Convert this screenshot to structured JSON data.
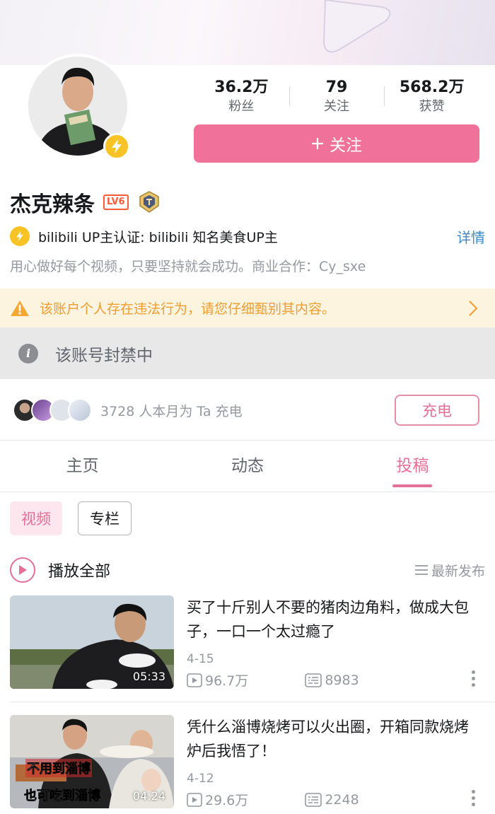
{
  "profile": {
    "name": "杰克辣条",
    "level": "LV6",
    "stats": [
      {
        "value": "36.2万",
        "label": "粉丝"
      },
      {
        "value": "79",
        "label": "关注"
      },
      {
        "value": "568.2万",
        "label": "获赞"
      }
    ],
    "follow_label": "关注",
    "verify_text": "bilibili UP主认证: bilibili 知名美食UP主",
    "detail_label": "详情",
    "bio": "用心做好每个视频，只要坚持就会成功。商业合作：Cy_sxe"
  },
  "warning": {
    "text": "该账户个人存在违法行为，请您仔细甄别其内容。"
  },
  "ban": {
    "text": "该账号封禁中"
  },
  "charge": {
    "text": "3728 人本月为 Ta 充电",
    "button": "充电"
  },
  "tabs": [
    {
      "label": "主页"
    },
    {
      "label": "动态"
    },
    {
      "label": "投稿"
    }
  ],
  "chips": [
    {
      "label": "视频"
    },
    {
      "label": "专栏"
    }
  ],
  "play_all": {
    "label": "播放全部",
    "sort_label": "最新发布"
  },
  "videos": [
    {
      "title": "买了十斤别人不要的猪肉边角料，做成大包子，一口一个太过瘾了",
      "date": "4-15",
      "duration": "05:33",
      "views": "96.7万",
      "danmaku": "8983"
    },
    {
      "title": "凭什么淄博烧烤可以火出圈，开箱同款烧烤炉后我悟了！",
      "date": "4-12",
      "duration": "04:24",
      "views": "29.6万",
      "danmaku": "2248",
      "caption_1": "不用到淄博",
      "caption_2": "也可吃到淄博"
    }
  ],
  "colors": {
    "accent": "#f0719a",
    "pink_text": "#e66f95",
    "warning": "#f19c2f",
    "link": "#3c89c9"
  }
}
